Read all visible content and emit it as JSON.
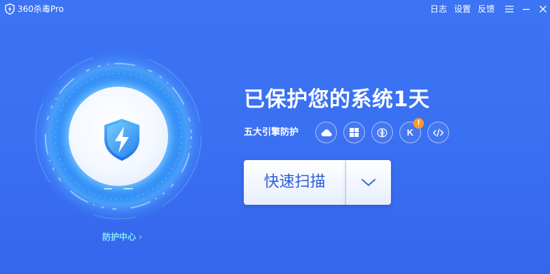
{
  "titlebar": {
    "app_title": "360杀毒Pro",
    "log_label": "日志",
    "settings_label": "设置",
    "feedback_label": "反馈",
    "menu_icon": "hamburger-menu-icon",
    "minimize_icon": "minimize-icon",
    "close_icon": "close-icon"
  },
  "status": {
    "title": "已保护您的系统1天"
  },
  "engines": {
    "label": "五大引擎防护",
    "items": [
      {
        "name": "cloud",
        "icon": "cloud-icon"
      },
      {
        "name": "windows",
        "icon": "windows-icon"
      },
      {
        "name": "ai",
        "icon": "brain-icon"
      },
      {
        "name": "k",
        "text": "K",
        "icon": "k-engine-icon",
        "alert": "!"
      },
      {
        "name": "code",
        "icon": "code-icon"
      }
    ]
  },
  "scan": {
    "label": "快速扫描",
    "dropdown_icon": "chevron-down-icon"
  },
  "protection_center": {
    "label": "防护中心",
    "chevron": "›"
  },
  "colors": {
    "background": "#3a6ff2",
    "accent_text": "#7fe7ff",
    "scan_text": "#2d5fd6",
    "alert": "#ff9a2a"
  }
}
